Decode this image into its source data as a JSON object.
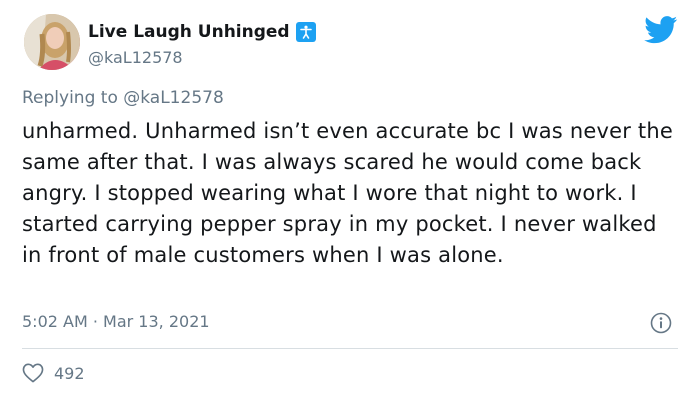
{
  "user": {
    "display_name": "Live Laugh Unhinged",
    "handle": "@kaL12578"
  },
  "reply": {
    "prefix": "Replying to ",
    "mention": "@kaL12578"
  },
  "tweet": {
    "text": "unharmed. Unharmed isn’t even accurate bc I was never the same after that. I was always scared he would come back angry. I stopped wearing what I wore that night to work. I started carrying pepper spray in my pocket. I never walked in front of male customers when I was alone.",
    "timestamp": "5:02 AM · Mar 13, 2021"
  },
  "stats": {
    "likes": "492"
  },
  "colors": {
    "twitter_blue": "#1da1f2",
    "muted_text": "#657786",
    "body_text": "#14171a"
  },
  "icons": {
    "brand": "twitter-bird-icon",
    "badge": "accessibility-badge-icon",
    "info": "info-icon",
    "like": "heart-icon"
  }
}
